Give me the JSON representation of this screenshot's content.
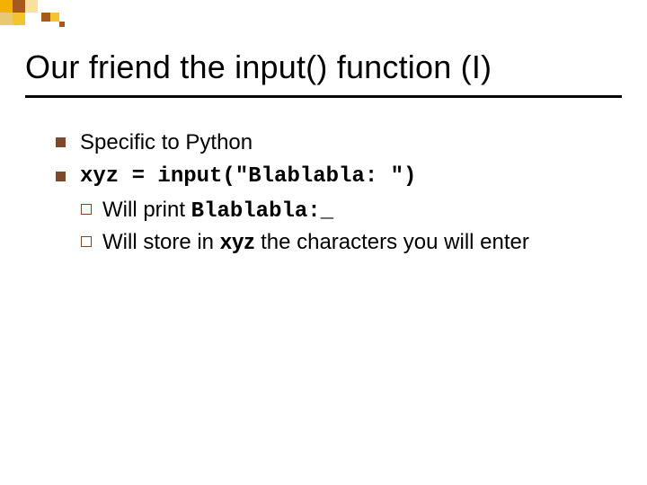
{
  "title": "Our friend the input() function (I)",
  "bullets": [
    {
      "text": "Specific to Python"
    },
    {
      "text": "xyz = input(\"Blablabla: \")",
      "sub": [
        {
          "pre": "Will print ",
          "code": "Blablabla:_"
        },
        {
          "pre": "Will store in ",
          "bold": "xyz",
          "post": " the characters you will enter"
        }
      ]
    }
  ]
}
